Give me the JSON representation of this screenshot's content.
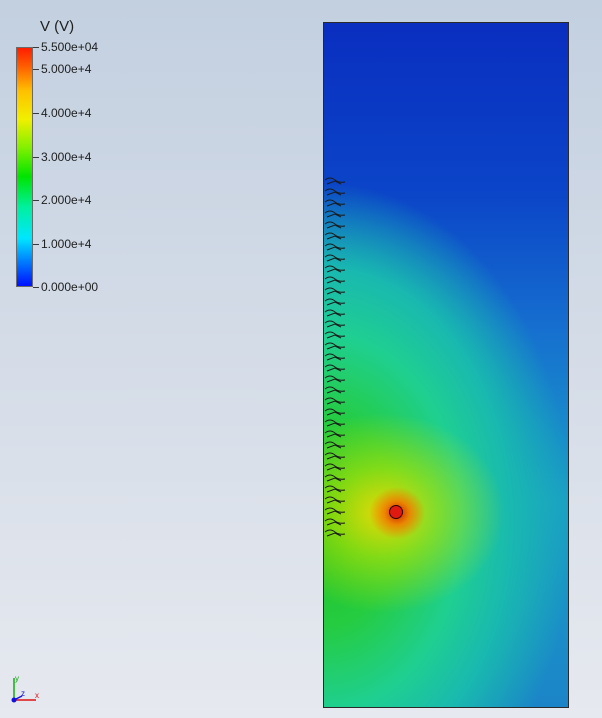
{
  "legend": {
    "title": "V (V)",
    "ticks": [
      "5.500e+04",
      "5.000e+4",
      "4.000e+4",
      "3.000e+4",
      "2.000e+4",
      "1.000e+4",
      "0.000e+00"
    ],
    "range": [
      0,
      55000
    ]
  },
  "viewport": {
    "electrode_color": "#e01a10",
    "boundary_color": "#2a2a2a"
  },
  "axes_triad": {
    "labels": [
      "y",
      "z",
      "x"
    ],
    "colors": {
      "x": "#e01010",
      "y": "#10b010",
      "z": "#1010e0"
    }
  }
}
